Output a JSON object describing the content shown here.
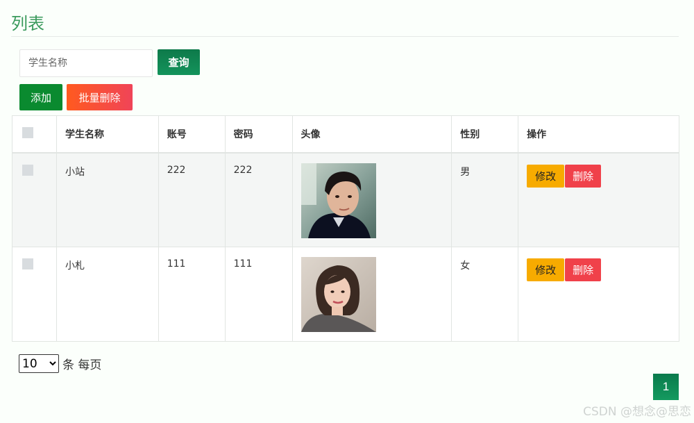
{
  "page": {
    "title": "列表"
  },
  "search": {
    "placeholder": "学生名称",
    "button_label": "查询"
  },
  "toolbar": {
    "add_label": "添加",
    "batch_delete_label": "批量删除"
  },
  "table": {
    "headers": [
      "学生名称",
      "账号",
      "密码",
      "头像",
      "性别",
      "操作"
    ],
    "rows": [
      {
        "name": "小站",
        "account": "222",
        "password": "222",
        "gender": "男",
        "avatar": "male-portrait"
      },
      {
        "name": "小札",
        "account": "111",
        "password": "111",
        "gender": "女",
        "avatar": "female-portrait"
      }
    ],
    "edit_label": "修改",
    "delete_label": "删除"
  },
  "pagination": {
    "page_size": "10",
    "page_size_options": [
      "10"
    ],
    "per_page_text": "条 每页",
    "current_page": "1"
  },
  "watermark": "CSDN @想念@思恋",
  "colors": {
    "title": "#3a9a5c",
    "primary": "#13935b",
    "add": "#0a8a2f",
    "danger": "#f0414a",
    "warning": "#f7ab00"
  }
}
